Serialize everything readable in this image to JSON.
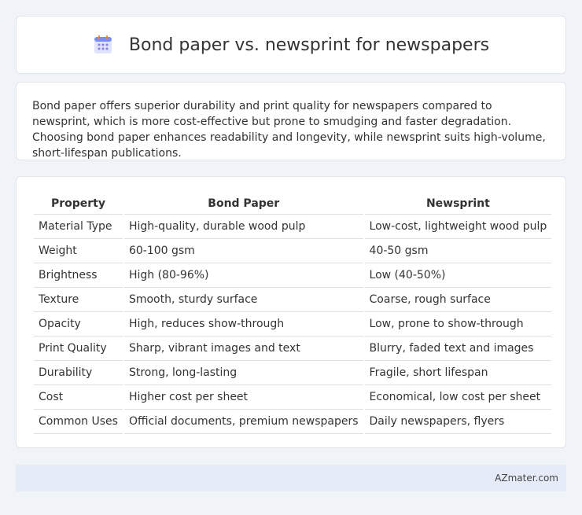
{
  "header": {
    "title": "Bond paper vs. newsprint for newspapers",
    "icon": "calendar-icon"
  },
  "intro": {
    "text": "Bond paper offers superior durability and print quality for newspapers compared to newsprint, which is more cost-effective but prone to smudging and faster degradation. Choosing bond paper enhances readability and longevity, while newsprint suits high-volume, short-lifespan publications."
  },
  "table": {
    "headers": [
      "Property",
      "Bond Paper",
      "Newsprint"
    ],
    "rows": [
      [
        "Material Type",
        "High-quality, durable wood pulp",
        "Low-cost, lightweight wood pulp"
      ],
      [
        "Weight",
        "60-100 gsm",
        "40-50 gsm"
      ],
      [
        "Brightness",
        "High (80-96%)",
        "Low (40-50%)"
      ],
      [
        "Texture",
        "Smooth, sturdy surface",
        "Coarse, rough surface"
      ],
      [
        "Opacity",
        "High, reduces show-through",
        "Low, prone to show-through"
      ],
      [
        "Print Quality",
        "Sharp, vibrant images and text",
        "Blurry, faded text and images"
      ],
      [
        "Durability",
        "Strong, long-lasting",
        "Fragile, short lifespan"
      ],
      [
        "Cost",
        "Higher cost per sheet",
        "Economical, low cost per sheet"
      ],
      [
        "Common Uses",
        "Official documents, premium newspapers",
        "Daily newspapers, flyers"
      ]
    ]
  },
  "footer": {
    "brand": "AZmater.com"
  }
}
